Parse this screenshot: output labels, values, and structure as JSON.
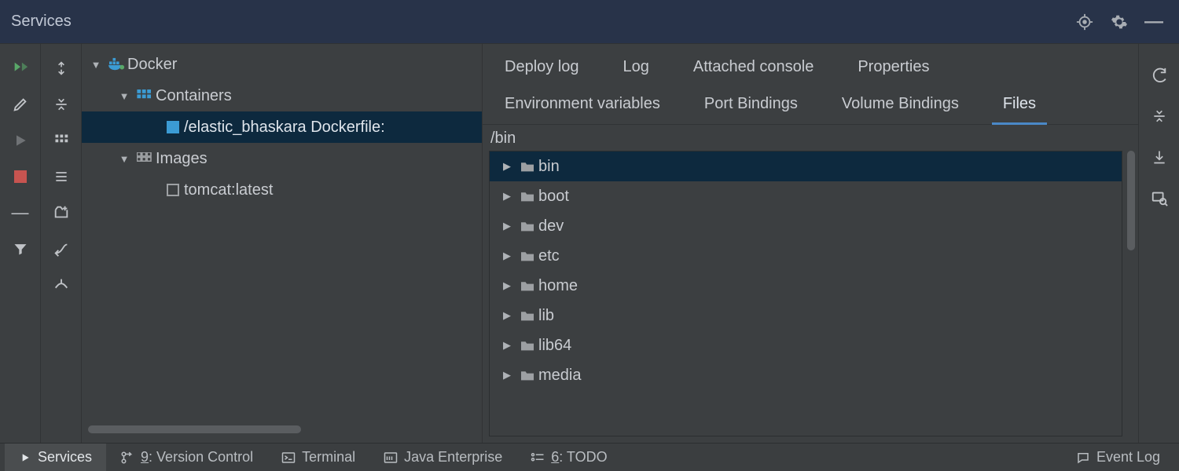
{
  "panel": {
    "title": "Services"
  },
  "tree": {
    "root_label": "Docker",
    "containers_label": "Containers",
    "container_name": "/elastic_bhaskara Dockerfile:",
    "images_label": "Images",
    "image_name": "tomcat:latest"
  },
  "tabs": {
    "row1": [
      "Deploy log",
      "Log",
      "Attached console",
      "Properties"
    ],
    "row2": [
      "Environment variables",
      "Port Bindings",
      "Volume Bindings",
      "Files"
    ],
    "active": "Files"
  },
  "files": {
    "current_path": "/bin",
    "entries": [
      "bin",
      "boot",
      "dev",
      "etc",
      "home",
      "lib",
      "lib64",
      "media"
    ],
    "selected": "bin"
  },
  "statusbar": {
    "services": "Services",
    "version_control_num": "9",
    "version_control_label": ": Version Control",
    "terminal": "Terminal",
    "java_enterprise": "Java Enterprise",
    "todo_num": "6",
    "todo_label": ": TODO",
    "event_log": "Event Log"
  }
}
